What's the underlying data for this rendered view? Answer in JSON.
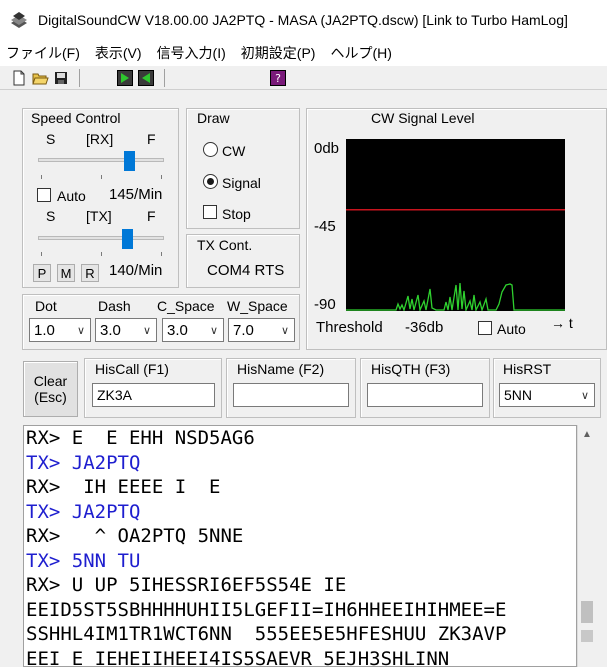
{
  "window": {
    "title": "DigitalSoundCW V18.00.00 JA2PTQ - MASA (JA2PTQ.dscw)  [Link to Turbo HamLog]"
  },
  "menu": [
    "ファイル(F)",
    "表示(V)",
    "信号入力(I)",
    "初期設定(P)",
    "ヘルプ(H)"
  ],
  "toolbar": {
    "icons": [
      "new-file-icon",
      "open-folder-icon",
      "save-icon",
      "play-forward-icon",
      "play-back-icon",
      "help-icon"
    ]
  },
  "speed": {
    "legend": "Speed Control",
    "rx": {
      "slow": "S",
      "label": "[RX]",
      "fast": "F",
      "auto_label": "Auto",
      "auto_checked": false,
      "value": "145/Min",
      "level": 0.75
    },
    "tx": {
      "slow": "S",
      "label": "[TX]",
      "fast": "F",
      "value": "140/Min",
      "level": 0.73
    },
    "buttons": [
      "P",
      "M",
      "R"
    ]
  },
  "draw": {
    "legend": "Draw",
    "options": [
      {
        "label": "CW",
        "type": "radio",
        "checked": false
      },
      {
        "label": "Signal",
        "type": "radio",
        "checked": true
      },
      {
        "label": "Stop",
        "type": "checkbox",
        "checked": false
      }
    ]
  },
  "txcont": {
    "legend": "TX Cont.",
    "value": "COM4 RTS"
  },
  "timing": {
    "labels": [
      "Dot",
      "Dash",
      "C_Space",
      "W_Space"
    ],
    "values": [
      "1.0",
      "3.0",
      "3.0",
      "7.0"
    ]
  },
  "cwlevel": {
    "legend": "CW Signal Level",
    "axis": [
      "0db",
      "-45",
      "-90"
    ],
    "threshold_label": "Threshold",
    "threshold_value": "-36db",
    "threshold_db": -36,
    "auto_label": "Auto",
    "auto_checked": false,
    "time_label": "→ t"
  },
  "fields": {
    "clear_line1": "Clear",
    "clear_line2": "(Esc)",
    "hiscall": {
      "label": "HisCall (F1)",
      "value": "ZK3A"
    },
    "hisname": {
      "label": "HisName (F2)",
      "value": ""
    },
    "hisqth": {
      "label": "HisQTH (F3)",
      "value": ""
    },
    "hisrst": {
      "label": "HisRST",
      "value": "5NN"
    }
  },
  "log": [
    {
      "kind": "rx",
      "text": "RX> E  E EHH NSD5AG6"
    },
    {
      "kind": "tx",
      "text": "TX> JA2PTQ"
    },
    {
      "kind": "rx",
      "text": "RX>  IH EEEE I  E"
    },
    {
      "kind": "tx",
      "text": "TX> JA2PTQ"
    },
    {
      "kind": "rx",
      "text": "RX>   ^ OA2PTQ 5NNE"
    },
    {
      "kind": "tx",
      "text": "TX> 5NN TU"
    },
    {
      "kind": "rx",
      "text": "RX> U UP 5IHESSRI6EF5S54E IE"
    },
    {
      "kind": "cont",
      "text": "EEID5ST5SBHHHHUHII5LGEFII=IH6HHEEIHIHMEE=E"
    },
    {
      "kind": "cont",
      "text": "SSHHL4IM1TR1WCT6NN  555EE5E5HFESHUU ZK3AVP"
    },
    {
      "kind": "cont",
      "text": "EEI E IEHEIIHEEI4IS5SAEVR 5EJH3SHLINN"
    }
  ]
}
